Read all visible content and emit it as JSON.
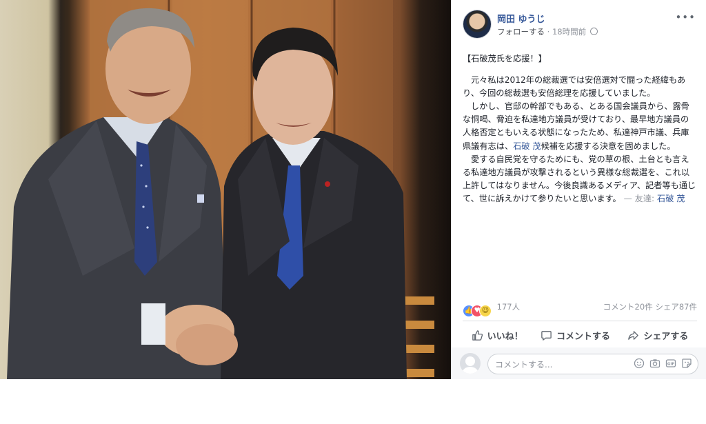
{
  "post": {
    "author": "岡田 ゆうじ",
    "follow_label": "フォローする",
    "separator": "·",
    "time": "18時間前",
    "more_icon": "•••",
    "heading": "【石破茂氏を応援！】",
    "para1": "元々私は2012年の総裁選では安倍選対で闘った経緯もあり、今回の総裁選も安倍総理を応援していました。",
    "para2_before": "しかし、官邸の幹部でもある、とある国会議員から、露骨な恫喝、脅迫を私達地方議員が受けており、最早地方議員の人格否定ともいえる状態になったため、私達神戸市議、兵庫県議有志は、",
    "para2_link": "石破 茂",
    "para2_after": "候補を応援する決意を固めました。",
    "para3": "愛する自民党を守るためにも、党の草の根、土台とも言える私達地方議員が攻撃されるという異様な総裁選を、これ以上許してはなりません。今後良識あるメディア、記者等も通じて、世に訴えかけて参りたいと思います。",
    "with_label": "— 友達:",
    "with_link": "石破 茂"
  },
  "reactions": {
    "count": "177人",
    "comments": "コメント20件",
    "shares": "シェア87件"
  },
  "actions": {
    "like": "いいね！",
    "comment": "コメントする",
    "share": "シェアする"
  },
  "comment_box": {
    "placeholder": "コメントする..."
  },
  "colors": {
    "link": "#365899",
    "meta": "#90949c",
    "like_blue": "#5890ff",
    "love_red": "#f25268"
  }
}
